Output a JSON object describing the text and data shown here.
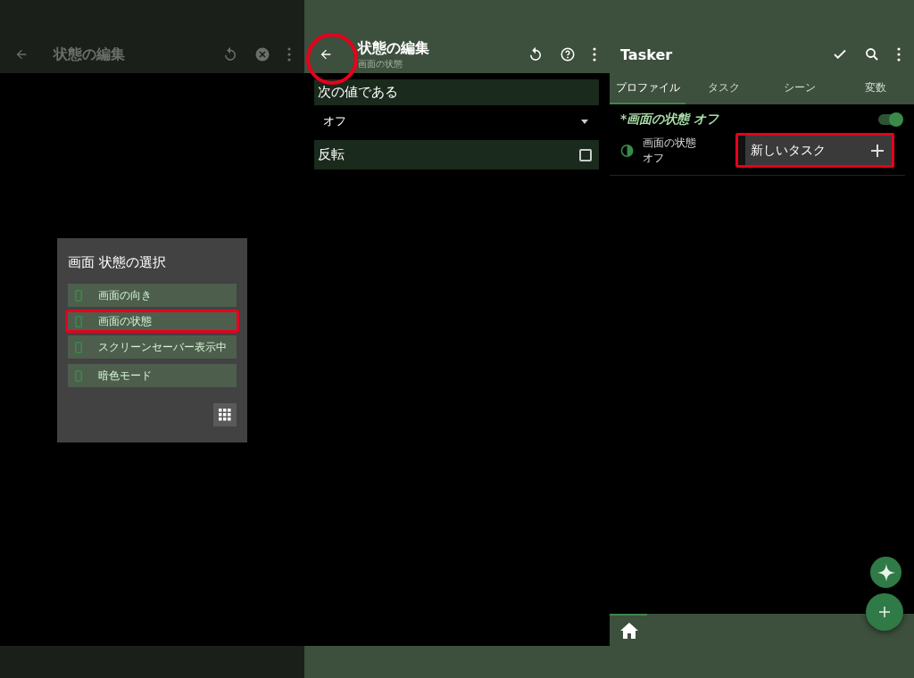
{
  "panels": [
    {
      "kind": "chooser",
      "toolbar": {
        "title": "状態の編集"
      },
      "dialog": {
        "title": "画面 状態の選択",
        "items": [
          {
            "label": "画面の向き",
            "highlighted": false
          },
          {
            "label": "画面の状態",
            "highlighted": true
          },
          {
            "label": "スクリーンセーバー表示中",
            "highlighted": false
          },
          {
            "label": "暗色モード",
            "highlighted": false
          }
        ]
      }
    },
    {
      "kind": "editor",
      "toolbar": {
        "title": "状態の編集",
        "subtitle": "画面の状態",
        "back_circled": true
      },
      "section": "次の値である",
      "dropdown": {
        "value": "オフ"
      },
      "invert": {
        "label": "反転",
        "checked": false
      }
    },
    {
      "kind": "list",
      "toolbar": {
        "title": "Tasker"
      },
      "tabs": [
        {
          "label": "プロファイル",
          "selected": true
        },
        {
          "label": "タスク",
          "selected": false
        },
        {
          "label": "シーン",
          "selected": false
        },
        {
          "label": "変数",
          "selected": false
        }
      ],
      "profile": {
        "name": "*画面の状態 オフ",
        "on": true,
        "context": [
          "画面の状態",
          "オフ"
        ],
        "task": {
          "label": "新しいタスク",
          "highlighted": true
        }
      }
    }
  ]
}
